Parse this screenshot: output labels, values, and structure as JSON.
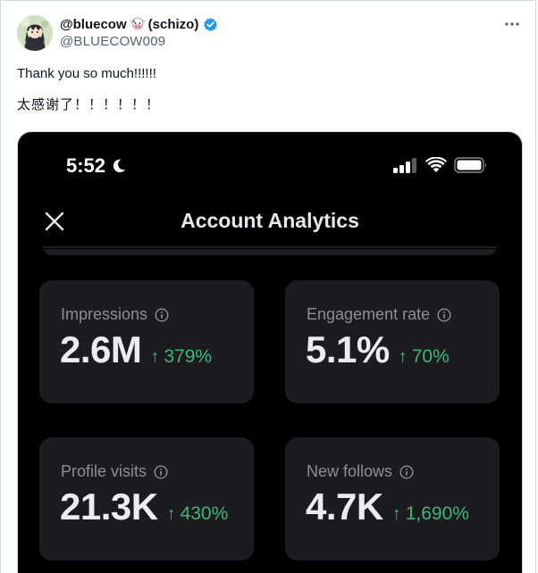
{
  "tweet": {
    "display_name": "@bluecow",
    "name_suffix": "(schizo)",
    "handle": "@BLUECOW009",
    "text_line1": "Thank you so much!!!!!!",
    "text_line2": "太感谢了！！！！！！",
    "avatar_icon": "anime-avatar-icon",
    "badge_icon": "verified-badge-icon",
    "emoji_icon": "cow-face-icon",
    "more_icon": "more-horizontal-icon",
    "verified_color": "#1d9bf0"
  },
  "phone": {
    "status_time": "5:52",
    "status_icons": [
      "moon-icon",
      "signal-icon",
      "wifi-icon",
      "battery-icon"
    ],
    "screen_title": "Account Analytics",
    "close_icon": "close-icon"
  },
  "stats": [
    {
      "label": "Impressions",
      "value": "2.6M",
      "change": "379%"
    },
    {
      "label": "Engagement rate",
      "value": "5.1%",
      "change": "70%"
    },
    {
      "label": "Profile visits",
      "value": "21.3K",
      "change": "430%"
    },
    {
      "label": "New follows",
      "value": "4.7K",
      "change": "1,690%"
    }
  ],
  "colors": {
    "positive_change": "#3fb57c",
    "card_background": "#1c1c1e",
    "screen_background": "#000000"
  }
}
